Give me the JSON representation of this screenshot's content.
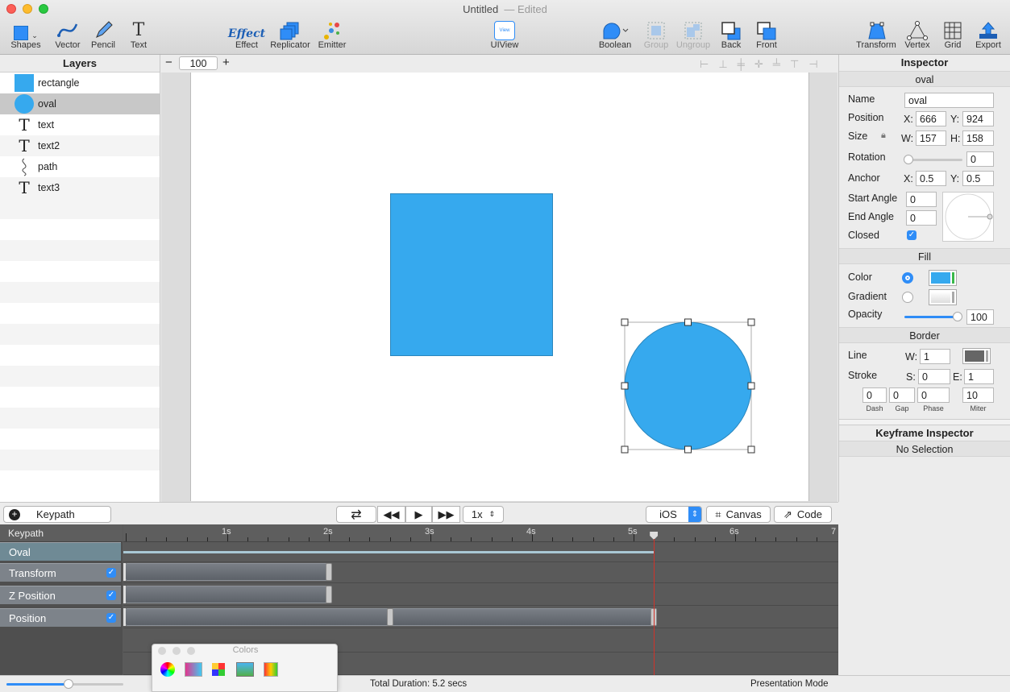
{
  "window": {
    "title": "Untitled",
    "edited": "— Edited"
  },
  "toolbar": {
    "left": [
      {
        "label": "Shapes",
        "icon": "square-icon"
      },
      {
        "label": "Vector",
        "icon": "vector-pen-icon"
      },
      {
        "label": "Pencil",
        "icon": "pencil-icon"
      },
      {
        "label": "Text",
        "icon": "text-T-icon"
      }
    ],
    "center": [
      {
        "label": "Effect",
        "icon": "effect-icon"
      },
      {
        "label": "Replicator",
        "icon": "replicator-icon"
      },
      {
        "label": "Emitter",
        "icon": "emitter-icon"
      }
    ],
    "uiview": {
      "label": "UIView",
      "badge": "View"
    },
    "right": [
      {
        "label": "Boolean"
      },
      {
        "label": "Group"
      },
      {
        "label": "Ungroup"
      },
      {
        "label": "Back"
      },
      {
        "label": "Front"
      }
    ],
    "far": [
      {
        "label": "Transform"
      },
      {
        "label": "Vertex"
      },
      {
        "label": "Grid"
      },
      {
        "label": "Export"
      }
    ]
  },
  "layers": {
    "title": "Layers",
    "items": [
      {
        "name": "rectangle",
        "icon": "rectangle-icon"
      },
      {
        "name": "oval",
        "icon": "oval-icon",
        "selected": true
      },
      {
        "name": "text",
        "icon": "text-icon"
      },
      {
        "name": "text2",
        "icon": "text-icon"
      },
      {
        "name": "path",
        "icon": "path-icon"
      },
      {
        "name": "text3",
        "icon": "text-icon"
      }
    ]
  },
  "zoom": {
    "value": "100",
    "minus": "−",
    "plus": "+"
  },
  "inspector": {
    "title": "Inspector",
    "subtitle": "oval",
    "name_label": "Name",
    "name_value": "oval",
    "position_label": "Position",
    "pos_x": "666",
    "pos_y": "924",
    "size_label": "Size",
    "width": "157",
    "height": "158",
    "rotation_label": "Rotation",
    "rotation": "0",
    "anchor_label": "Anchor",
    "anchor_x": "0.5",
    "anchor_y": "0.5",
    "start_angle_label": "Start Angle",
    "start_angle": "0",
    "end_angle_label": "End Angle",
    "end_angle": "0",
    "closed_label": "Closed",
    "fill_title": "Fill",
    "color_label": "Color",
    "gradient_label": "Gradient",
    "opacity_label": "Opacity",
    "opacity": "100",
    "border_title": "Border",
    "line_label": "Line",
    "line_w": "1",
    "stroke_label": "Stroke",
    "stroke_s": "0",
    "stroke_e": "1",
    "dash": "0",
    "gap": "0",
    "phase": "0",
    "miter": "10",
    "dash_label": "Dash",
    "gap_label": "Gap",
    "phase_label": "Phase",
    "miter_label": "Miter",
    "x_lbl": "X:",
    "y_lbl": "Y:",
    "w_lbl": "W:",
    "h_lbl": "H:",
    "s_lbl": "S:",
    "e_lbl": "E:",
    "keyframe_title": "Keyframe Inspector",
    "keyframe_status": "No Selection",
    "fill_color": "#36a9ee"
  },
  "controls": {
    "keypath_button": "Keypath",
    "speed": "1x",
    "platform": "iOS",
    "canvas_button": "Canvas",
    "code_button": "Code"
  },
  "timeline": {
    "header": "Keypath",
    "ticks": [
      "1s",
      "2s",
      "3s",
      "4s",
      "5s",
      "6s",
      "7"
    ],
    "rows": [
      {
        "label": "Oval",
        "check": false
      },
      {
        "label": "Transform",
        "check": true
      },
      {
        "label": "Z Position",
        "check": true
      },
      {
        "label": "Position",
        "check": true
      }
    ],
    "playhead_seconds": 5.2
  },
  "status": {
    "total_duration": "Total Duration: 5.2 secs",
    "presentation_mode": "Presentation Mode"
  },
  "colors_panel": {
    "title": "Colors"
  }
}
